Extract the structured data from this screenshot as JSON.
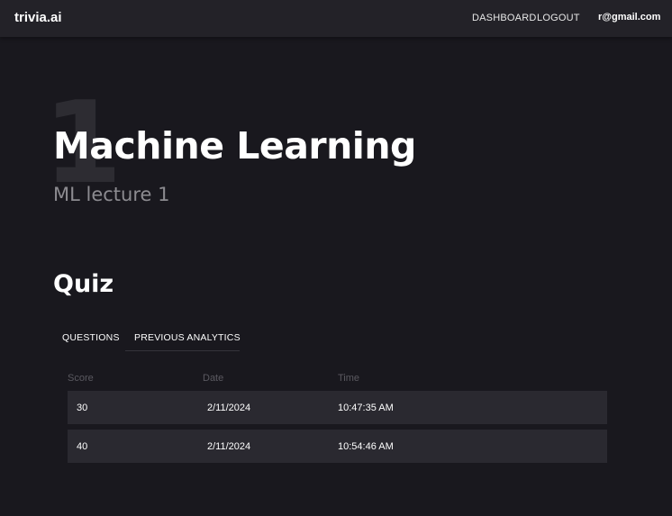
{
  "nav": {
    "brand": "trivia.ai",
    "links": [
      "DASHBOARD",
      "LOGOUT"
    ],
    "user": "r@gmail.com"
  },
  "header": {
    "number": "1",
    "title": "Machine Learning",
    "subtitle": "ML lecture 1"
  },
  "quiz": {
    "title": "Quiz",
    "tabs": [
      "QUESTIONS",
      "PREVIOUS ANALYTICS"
    ],
    "active_tab": "PREVIOUS ANALYTICS",
    "table": {
      "columns": [
        "Score",
        "Date",
        "Time"
      ],
      "rows": [
        {
          "score": "30",
          "date": "2/11/2024",
          "time": "10:47:35 AM"
        },
        {
          "score": "40",
          "date": "2/11/2024",
          "time": "10:54:46 AM"
        }
      ]
    }
  },
  "colors": {
    "background": "#19181e",
    "navbar": "#232228",
    "row": "#2a2930",
    "muted": "#8c8b90"
  }
}
